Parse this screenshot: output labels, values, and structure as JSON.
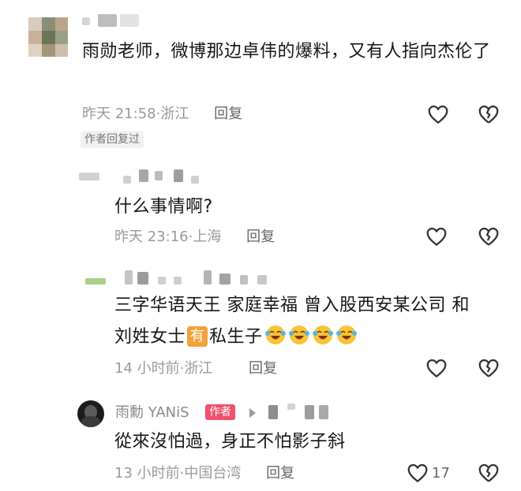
{
  "comments": [
    {
      "text": "雨勋老师，微博那边卓伟的爆料，又有人指向杰伦了",
      "time": "昨天 21:58",
      "location": "浙江",
      "reply_label": "回复",
      "author_replied": "作者回复过"
    },
    {
      "text": "什么事情啊?",
      "time": "昨天 23:16",
      "location": "上海",
      "reply_label": "回复"
    },
    {
      "text_line1": "三字华语天王 家庭幸福 曾入股西安某公司 和",
      "text_line2_pre": "刘姓女士",
      "badge": "有",
      "text_line2_post": "私生子",
      "time": "14 小时前",
      "location": "浙江",
      "reply_label": "回复"
    },
    {
      "author": "雨勳 YANiS",
      "author_tag": "作者",
      "text": "從來沒怕過，身正不怕影子斜",
      "time": "13 小时前",
      "location": "中国台湾",
      "reply_label": "回复",
      "like_count": "17"
    }
  ],
  "icons": {
    "like": "heart-outline-icon",
    "dislike": "broken-heart-icon",
    "emoji": "laughing-crying-emoji",
    "play": "play-triangle-icon"
  },
  "colors": {
    "text": "#161616",
    "meta": "#9a9a9a",
    "author_tag_bg": "#f0516b",
    "badge_bg": "#f4a13c"
  }
}
